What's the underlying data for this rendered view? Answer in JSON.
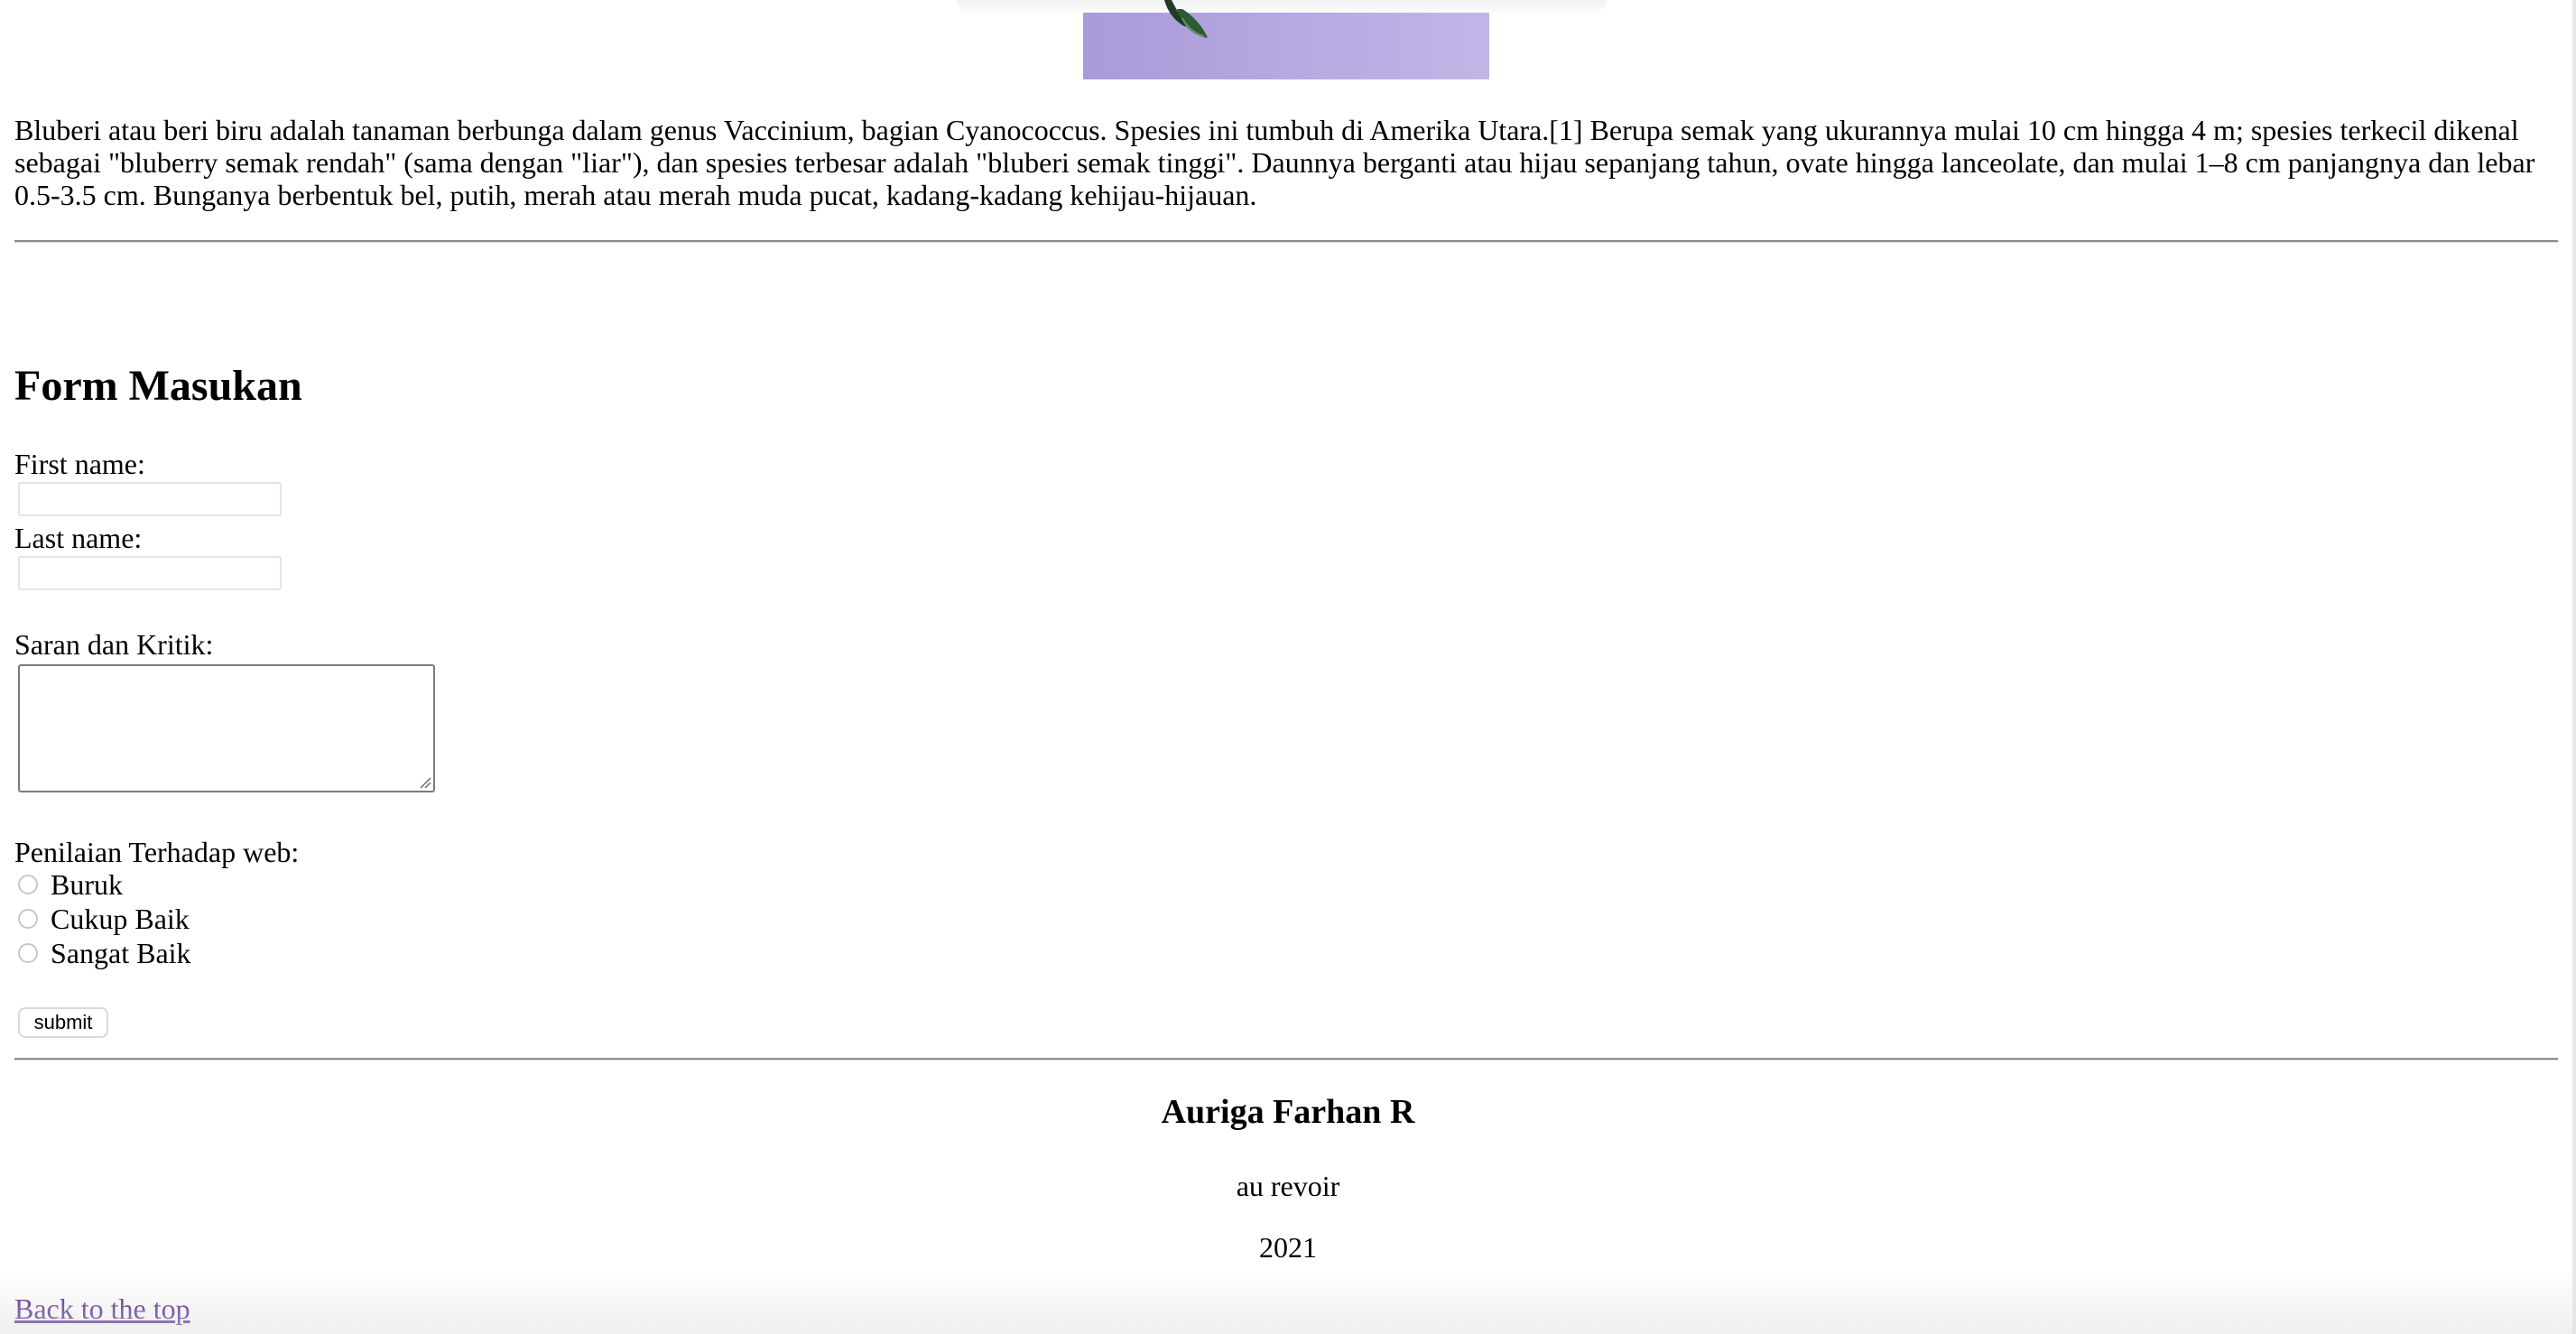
{
  "article": {
    "description": "Bluberi atau beri biru adalah tanaman berbunga dalam genus Vaccinium, bagian Cyanococcus. Spesies ini tumbuh di Amerika Utara.[1] Berupa semak yang ukurannya mulai 10 cm hingga 4 m; spesies terkecil dikenal sebagai \"bluberry semak rendah\" (sama dengan \"liar\"), dan spesies terbesar adalah \"bluberi semak tinggi\". Daunnya berganti atau hijau sepanjang tahun, ovate hingga lanceolate, dan mulai 1–8 cm panjangnya dan lebar 0.5-3.5 cm. Bunganya berbentuk bel, putih, merah atau merah muda pucat, kadang-kadang kehijau-hijauan."
  },
  "form": {
    "title": "Form Masukan",
    "first_name_label": "First name:",
    "first_name_value": "",
    "last_name_label": "Last name:",
    "last_name_value": "",
    "feedback_label": "Saran dan Kritik:",
    "feedback_value": "",
    "rating_label": "Penilaian Terhadap web:",
    "rating_options": [
      "Buruk",
      "Cukup Baik",
      "Sangat Baik"
    ],
    "submit_label": "submit"
  },
  "footer": {
    "name": "Auriga Farhan R",
    "line1": "au revoir",
    "line2": "2021",
    "back_link": "Back to the top"
  },
  "colors": {
    "hero_image": "#b3a4df",
    "link_visited": "#4b1a8a",
    "rule": "#8e8e8e"
  },
  "icons": {
    "hero": "blueberry-plant-image"
  }
}
